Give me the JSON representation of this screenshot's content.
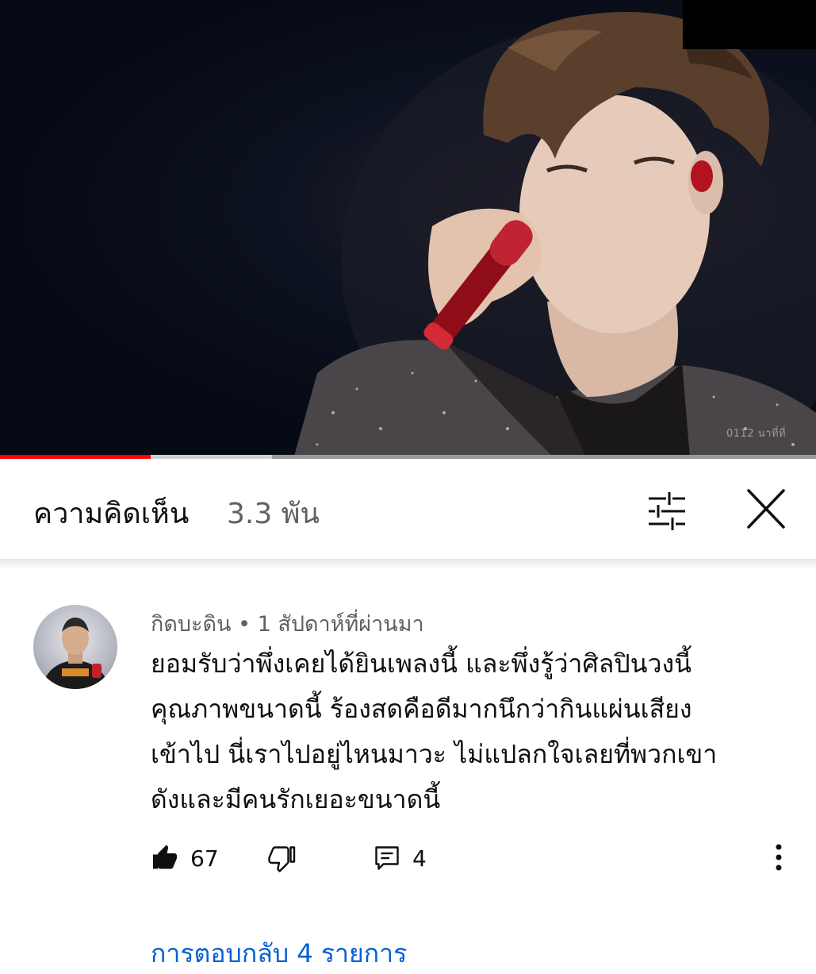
{
  "video": {
    "watermark": "0112 นาที่ที่",
    "progress": {
      "played_fraction": 0.185,
      "buffered_fraction": 0.333
    },
    "colors": {
      "played": "#ff0000",
      "buffered": "#cfcfcf",
      "track": "#9a9a9a"
    }
  },
  "comments_header": {
    "title": "ความคิดเห็น",
    "count": "3.3 พัน",
    "filter_icon": "sort-filter-icon",
    "close_icon": "close-icon"
  },
  "comment": {
    "meta": "กิดบะดิน • 1 สัปดาห์ที่ผ่านมา",
    "text": "ยอมรับว่าพึ่งเคยได้ยินเพลงนี้ และพึ่งรู้ว่าศิลปินวงนี้\nคุณภาพขนาดนี้ ร้องสดคือดีมากนึกว่ากินแผ่นเสียง\nเข้าไป นี่เราไปอยู่ไหนมาวะ ไม่แปลกใจเลยที่พวกเขา\nดังและมีคนรักเยอะขนาดนี้",
    "likes": "67",
    "replies": "4",
    "replies_link": "การตอบกลับ 4 รายการ"
  },
  "colors": {
    "link": "#065fd4",
    "text": "#0f0f0f",
    "secondary": "#606060"
  }
}
